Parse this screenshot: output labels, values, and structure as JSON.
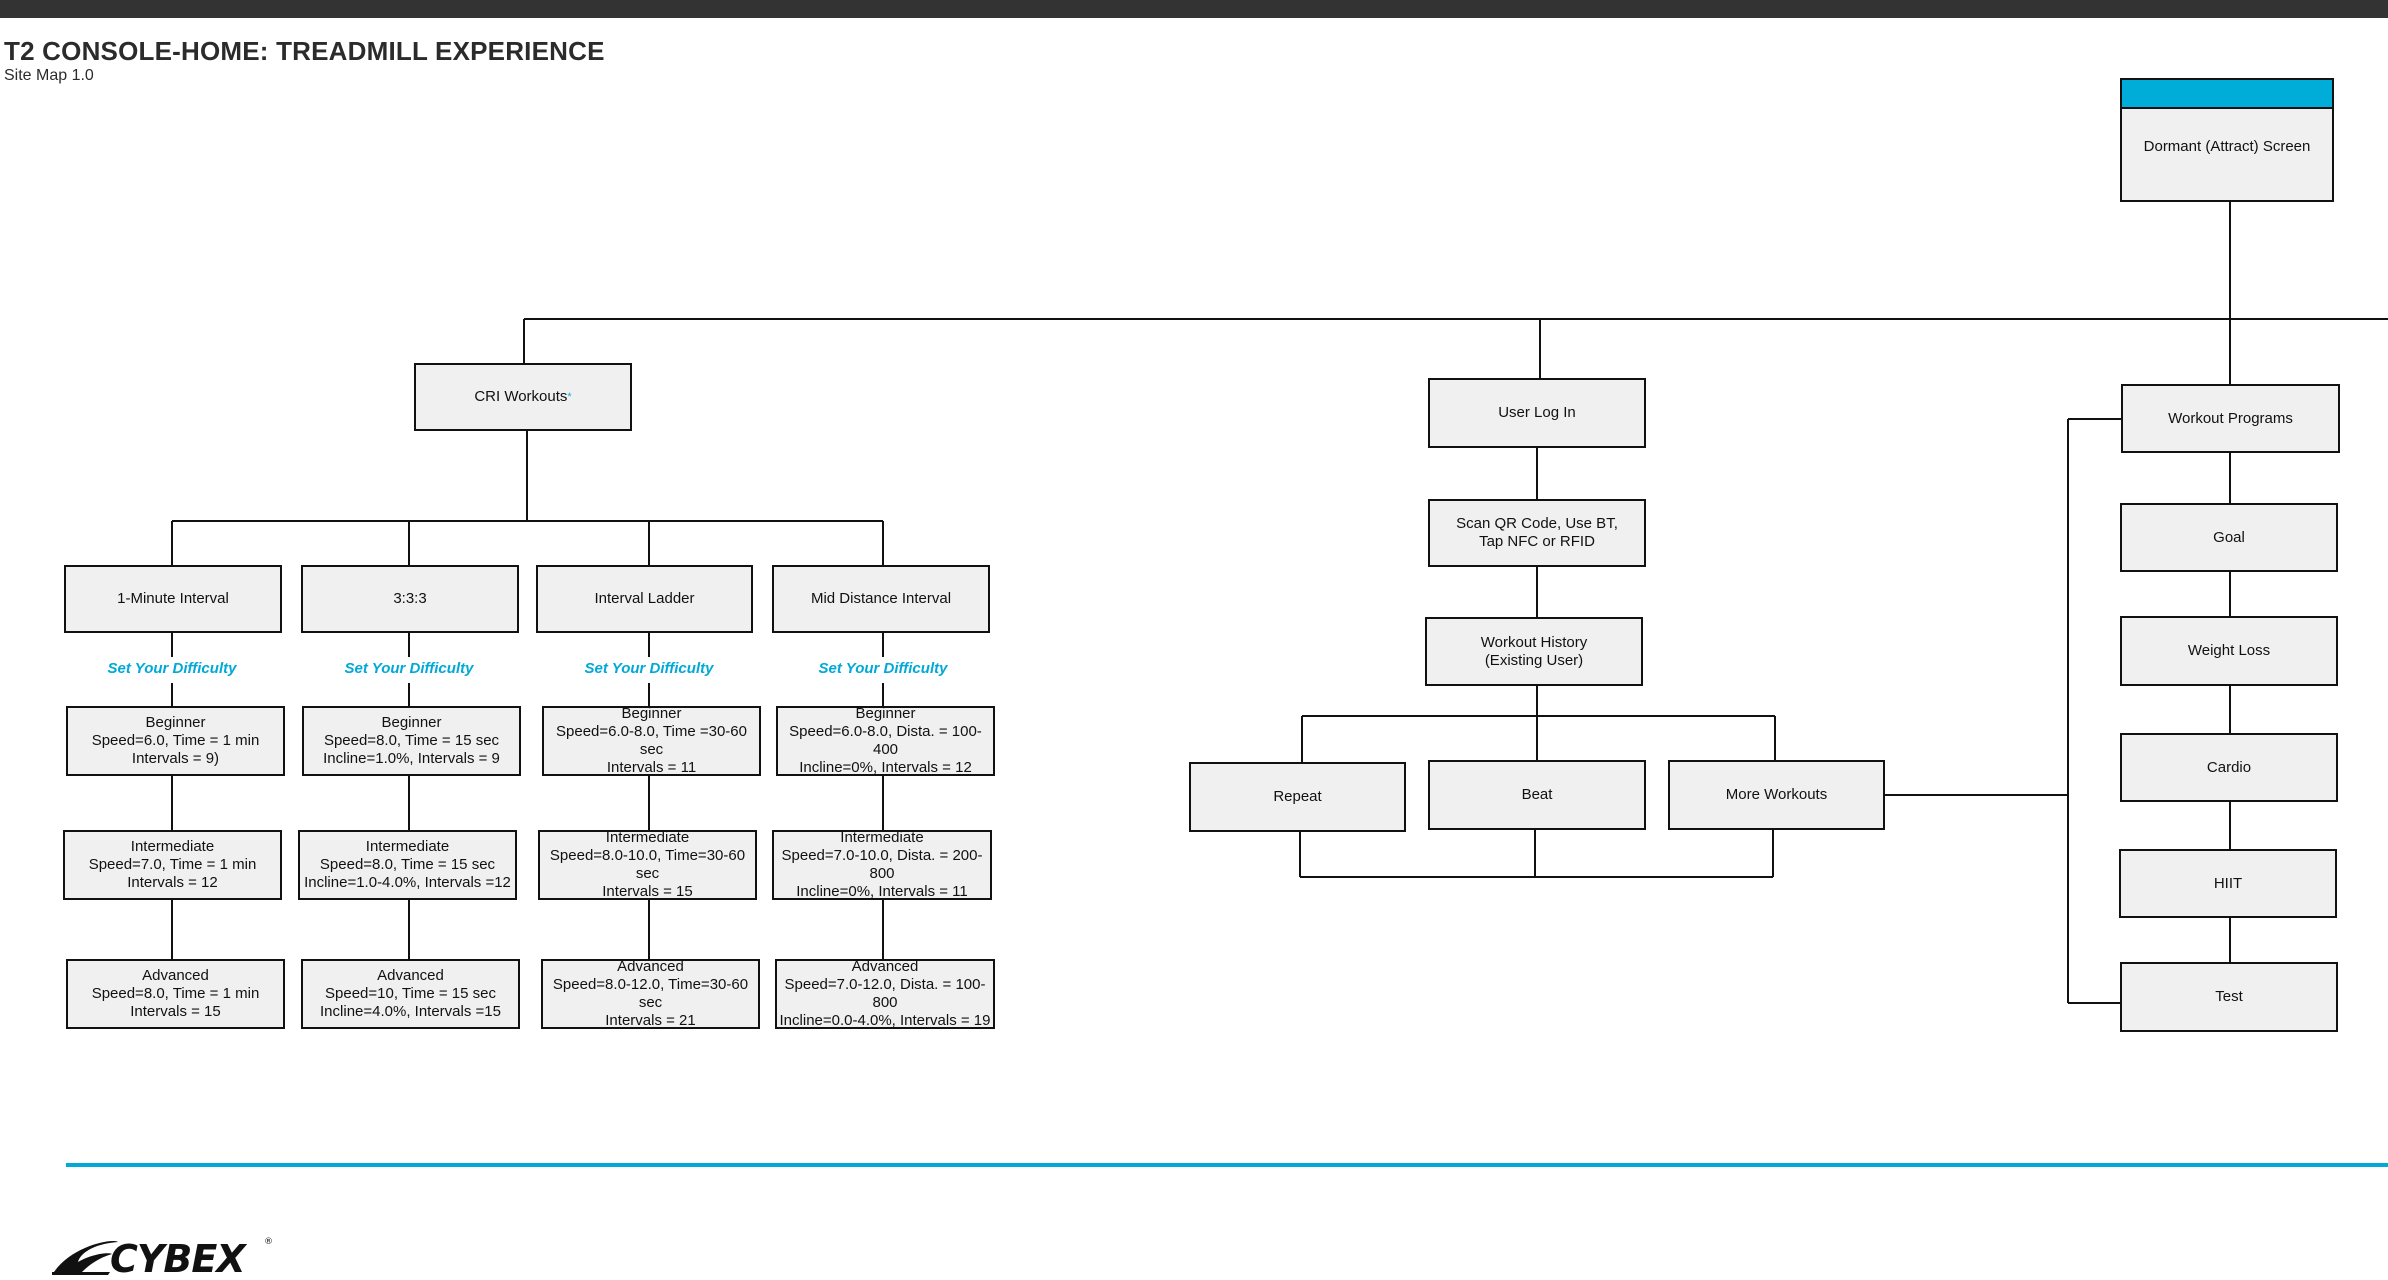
{
  "header": {
    "title": "T2 CONSOLE-HOME: TREADMILL EXPERIENCE",
    "subtitle": "Site Map 1.0"
  },
  "colors": {
    "accent": "#00A9D8",
    "node_fill": "#F0F0F0",
    "top_bar": "#333333"
  },
  "root": {
    "label": "Dormant (Attract) Screen"
  },
  "cri": {
    "label": "CRI Workouts",
    "marker": "*",
    "difficulty_label": "Set Your Difficulty",
    "workouts": [
      {
        "label": "1-Minute Interval",
        "levels": [
          {
            "name": "Beginner",
            "detail": "Speed=6.0,  Time =  1 min\nIntervals = 9)"
          },
          {
            "name": "Intermediate",
            "detail": "Speed=7.0,  Time =  1 min\nIntervals = 12"
          },
          {
            "name": "Advanced",
            "detail": "Speed=8.0,  Time =  1 min\nIntervals = 15"
          }
        ]
      },
      {
        "label": "3:3:3",
        "levels": [
          {
            "name": "Beginner",
            "detail": "Speed=8.0,  Time =  15 sec\nIncline=1.0%, Intervals = 9"
          },
          {
            "name": "Intermediate",
            "detail": "Speed=8.0,  Time =  15 sec\nIncline=1.0-4.0%, Intervals =12"
          },
          {
            "name": "Advanced",
            "detail": "Speed=10,  Time =  15 sec\nIncline=4.0%, Intervals =15"
          }
        ]
      },
      {
        "label": "Interval Ladder",
        "levels": [
          {
            "name": "Beginner",
            "detail": "Speed=6.0-8.0,  Time =30-60 sec\nIntervals = 11"
          },
          {
            "name": "Intermediate",
            "detail": "Speed=8.0-10.0, Time=30-60 sec\nIntervals = 15"
          },
          {
            "name": "Advanced",
            "detail": "Speed=8.0-12.0, Time=30-60 sec\nIntervals = 21"
          }
        ]
      },
      {
        "label": "Mid Distance Interval",
        "levels": [
          {
            "name": "Beginner",
            "detail": "Speed=6.0-8.0, Dista. = 100-400\nIncline=0%, Intervals = 12"
          },
          {
            "name": "Intermediate",
            "detail": "Speed=7.0-10.0, Dista. = 200-800\nIncline=0%, Intervals = 11"
          },
          {
            "name": "Advanced",
            "detail": "Speed=7.0-12.0, Dista. = 100-800\nIncline=0.0-4.0%, Intervals = 19"
          }
        ]
      }
    ]
  },
  "login": {
    "user_log_in": "User  Log In",
    "scan": "Scan QR Code, Use BT,\nTap NFC or RFID",
    "history": "Workout History\n(Existing User)",
    "options": [
      "Repeat",
      "Beat",
      "More Workouts"
    ]
  },
  "programs": {
    "label": "Workout Programs",
    "items": [
      "Goal",
      "Weight Loss",
      "Cardio",
      "HIIT",
      "Test"
    ]
  },
  "footer": {
    "logo_text": "CYBEX",
    "logo_mark": "®"
  }
}
